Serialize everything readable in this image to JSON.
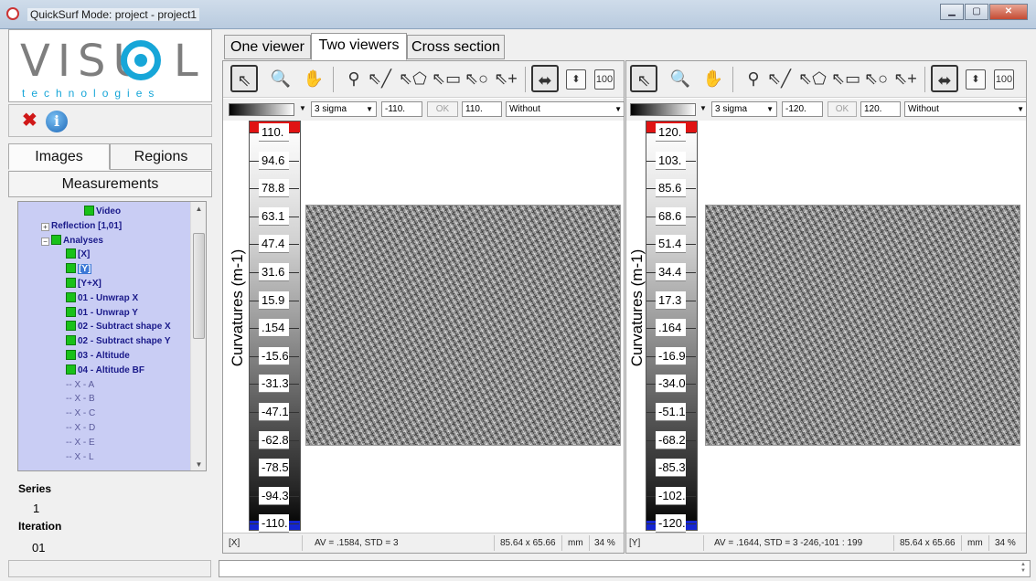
{
  "window": {
    "title": "QuickSurf Mode: project - project1",
    "controls": [
      "minimize",
      "maximize",
      "close"
    ]
  },
  "logo": {
    "main": "VISU  L",
    "sub": "technologies"
  },
  "left_panel": {
    "tabs": {
      "images": "Images",
      "regions": "Regions",
      "measurements": "Measurements"
    },
    "tree": [
      {
        "label": "Video",
        "level": 2,
        "icon": "green-square",
        "style": "bold"
      },
      {
        "label": "Reflection [1,01]",
        "level": 0,
        "icon": "plus",
        "style": "bold"
      },
      {
        "label": "Analyses",
        "level": 0,
        "icon": "minus-green",
        "style": "bold"
      },
      {
        "label": "[X]",
        "level": 1,
        "icon": "green-square",
        "style": "bold"
      },
      {
        "label": "[Y]",
        "level": 1,
        "icon": "green-square",
        "style": "bold",
        "selected": true
      },
      {
        "label": "[Y+X]",
        "level": 1,
        "icon": "green-square",
        "style": "bold"
      },
      {
        "label": "01 - Unwrap X",
        "level": 1,
        "icon": "green-square",
        "style": "bold"
      },
      {
        "label": "01 - Unwrap Y",
        "level": 1,
        "icon": "green-square",
        "style": "bold"
      },
      {
        "label": "02 - Subtract shape X",
        "level": 1,
        "icon": "green-square",
        "style": "bold"
      },
      {
        "label": "02 - Subtract shape Y",
        "level": 1,
        "icon": "green-square",
        "style": "bold"
      },
      {
        "label": "03 - Altitude",
        "level": 1,
        "icon": "green-square",
        "style": "bold"
      },
      {
        "label": "04 - Altitude BF",
        "level": 1,
        "icon": "green-square",
        "style": "bold"
      },
      {
        "label": "X - A",
        "level": 1,
        "icon": "none",
        "style": "light"
      },
      {
        "label": "X - B",
        "level": 1,
        "icon": "none",
        "style": "light"
      },
      {
        "label": "X - C",
        "level": 1,
        "icon": "none",
        "style": "light"
      },
      {
        "label": "X - D",
        "level": 1,
        "icon": "none",
        "style": "light"
      },
      {
        "label": "X - E",
        "level": 1,
        "icon": "none",
        "style": "light"
      },
      {
        "label": "X - L",
        "level": 1,
        "icon": "none",
        "style": "light"
      }
    ],
    "series_label": "Series",
    "series_value": "1",
    "iteration_label": "Iteration",
    "iteration_value": "01"
  },
  "main_tabs": [
    "One viewer",
    "Two viewers",
    "Cross section"
  ],
  "active_tab": "Two viewers",
  "viewers": [
    {
      "colormap_icon": "grayscale-gradient",
      "sigma": "3 sigma",
      "min": "-110.",
      "ok": "OK",
      "max": "110.",
      "mode": "Without",
      "axis_label": "Curvatures (m-1)",
      "scale_ticks": [
        "110.",
        "94.6",
        "78.8",
        "63.1",
        "47.4",
        "31.6",
        "15.9",
        ".154",
        "-15.6",
        "-31.3",
        "-47.1",
        "-62.8",
        "-78.5",
        "-94.3",
        "-110."
      ],
      "status": {
        "name": "[X]",
        "stats": "AV = .1584, STD = 3",
        "dims": "85.64 x 65.66",
        "unit": "mm",
        "zoom": "34 %"
      }
    },
    {
      "colormap_icon": "grayscale-gradient",
      "sigma": "3 sigma",
      "min": "-120.",
      "ok": "OK",
      "max": "120.",
      "mode": "Without",
      "axis_label": "Curvatures (m-1)",
      "scale_ticks": [
        "120.",
        "103.",
        "85.6",
        "68.6",
        "51.4",
        "34.4",
        "17.3",
        ".164",
        "-16.9",
        "-34.0",
        "-51.1",
        "-68.2",
        "-85.3",
        "-102.",
        "-120."
      ],
      "status": {
        "name": "[Y]",
        "stats": "AV = .1644, STD = 3 -246,-101 : 199",
        "dims": "85.64 x 65.66",
        "unit": "mm",
        "zoom": "34 %"
      }
    }
  ],
  "toolbar_icons": [
    "pointer-icon",
    "zoom-icon",
    "pan-hand-icon",
    "point-probe-icon",
    "line-tool-icon",
    "polygon-tool-icon",
    "rectangle-tool-icon",
    "circle-tool-icon",
    "add-point-icon",
    "fit-width-icon",
    "fit-height-icon",
    "zoom-100-icon"
  ],
  "zoom_100_label": "100"
}
